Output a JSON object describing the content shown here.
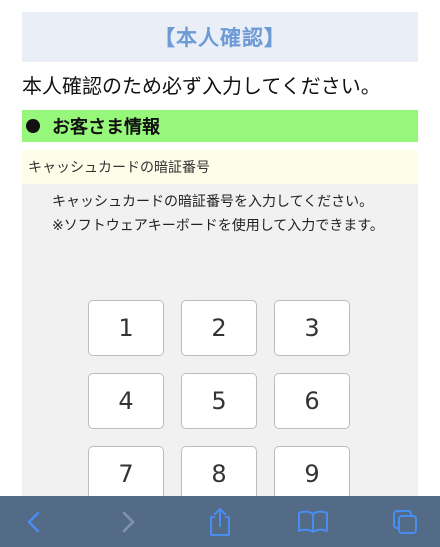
{
  "header": {
    "title": "【本人確認】"
  },
  "instruction": "本人確認のため必ず入力してください。",
  "section": {
    "title": "お客さま情報"
  },
  "field": {
    "label": "キャッシュカードの暗証番号",
    "help_line1": "キャッシュカードの暗証番号を入力してください。",
    "help_line2": "※ソフトウェアキーボードを使用して入力できます。"
  },
  "keypad": {
    "keys": [
      "1",
      "2",
      "3",
      "4",
      "5",
      "6",
      "7",
      "8",
      "9"
    ]
  },
  "toolbar": {
    "icons": [
      "back-icon",
      "forward-icon",
      "share-icon",
      "bookmarks-icon",
      "tabs-icon"
    ]
  },
  "colors": {
    "header_bg": "#e9eef7",
    "header_text": "#6d9bd6",
    "section_bg": "#97f77b",
    "field_label_bg": "#fdfde9",
    "panel_bg": "#f1f1f1",
    "toolbar_bg": "#546b87",
    "toolbar_icon": "#4a8df0"
  }
}
